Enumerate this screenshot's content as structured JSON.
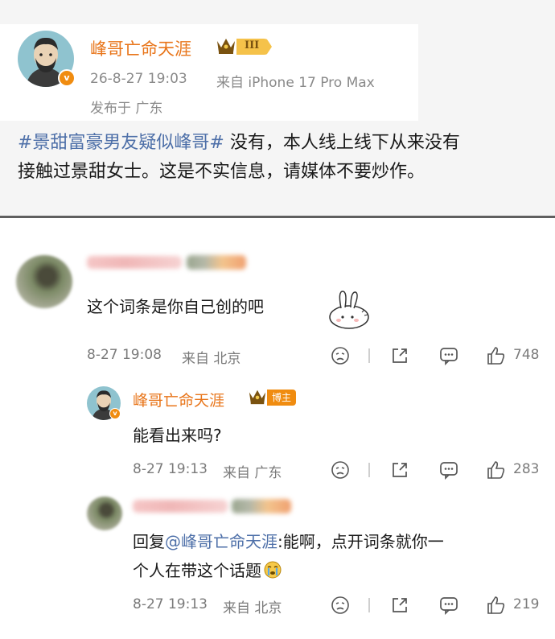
{
  "post": {
    "author": "峰哥亡命天涯",
    "level": "III",
    "timestamp": "26-8-27 19:03",
    "source": "来自 iPhone 17 Pro Max",
    "location": "发布于 广东",
    "topic": "#景甜富豪男友疑似峰哥#",
    "text_line1_rest": " 没有，本人线上线下从来没有",
    "text_line2": "接触过景甜女士。这是不实信息，请媒体不要炒作。",
    "verified_mark": "v"
  },
  "comments": [
    {
      "text": "这个词条是你自己创的吧",
      "time": "8-27 19:08",
      "from": "来自 北京",
      "likes": "748"
    },
    {
      "author": "峰哥亡命天涯",
      "host_label": "博主",
      "text": "能看出来吗?",
      "time": "8-27 19:13",
      "from": "来自 广东",
      "likes": "283"
    },
    {
      "reply_prefix": "回复",
      "mention": "@峰哥亡命天涯",
      "text_line1_rest": ":能啊，点开词条就你一",
      "text_line2": "个人在带这个话题",
      "time": "8-27 19:13",
      "from": "来自 北京",
      "likes": "219"
    }
  ],
  "icons": [
    "dislike-icon",
    "share-icon",
    "comment-icon",
    "like-icon"
  ],
  "colors": {
    "author": "#e8751a",
    "topic": "#4d6fa8",
    "badge": "#f08c10"
  }
}
